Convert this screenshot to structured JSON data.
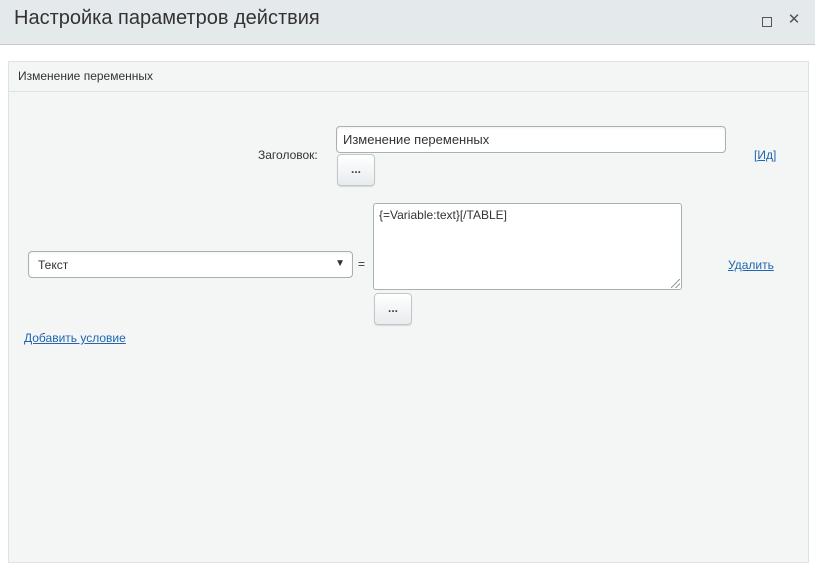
{
  "dialog": {
    "title": "Настройка параметров действия"
  },
  "panel": {
    "title": "Изменение переменных"
  },
  "form": {
    "heading_label": "Заголовок:",
    "heading_value": "Изменение переменных",
    "dots_label": "...",
    "id_link_prefix": "[",
    "id_link": "Ид",
    "id_link_suffix": "]"
  },
  "condition": {
    "variable_selected": "Текст",
    "operator": "=",
    "value": "{=Variable:text}[/TABLE]",
    "dots_label": "...",
    "delete_link": "Удалить"
  },
  "add_condition_link": "Добавить условие",
  "icons": {
    "maximize": "maximize-icon",
    "close": "close-icon",
    "dropdown": "dropdown-arrow-icon"
  }
}
